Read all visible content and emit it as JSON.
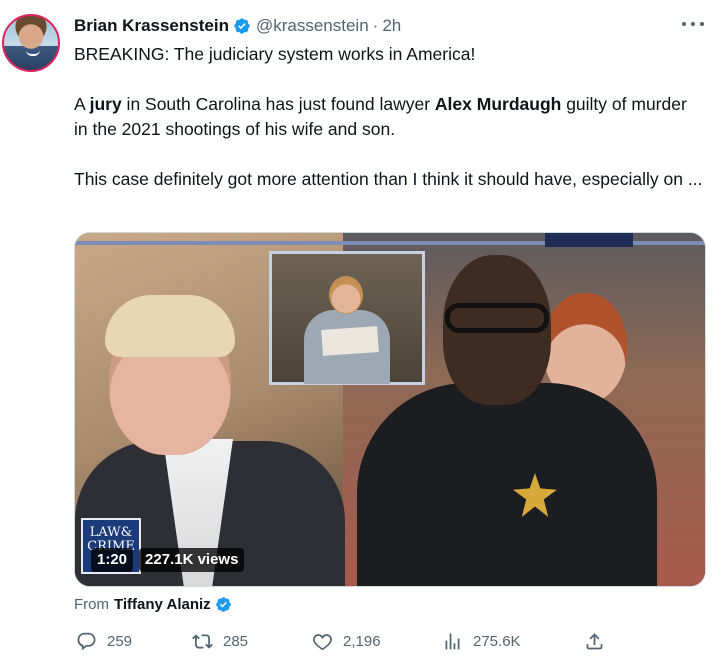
{
  "author": {
    "display_name": "Brian Krassenstein",
    "handle": "@krassenstein",
    "separator": "·",
    "time_ago": "2h"
  },
  "tweet": {
    "line1": "BREAKING:   The judiciary system works in America!",
    "p2_a": "A ",
    "p2_jury": "jury",
    "p2_b": " in South Carolina has just found lawyer ",
    "p2_name": "Alex Murdaugh",
    "p2_c": " guilty of murder in the 2021 shootings of his wife and son.",
    "p3": "This case definitely got more attention than I think it should have, especially on ..."
  },
  "media": {
    "logo_line1": "LAW&",
    "logo_line2": "CRIME",
    "duration": "1:20",
    "views": "227.1K views"
  },
  "attribution": {
    "prefix": "From",
    "name": "Tiffany Alaniz"
  },
  "actions": {
    "replies": "259",
    "retweets": "285",
    "likes": "2,196",
    "views": "275.6K"
  },
  "colors": {
    "verified_blue": "#1d9bf0",
    "secondary_text": "#536471",
    "avatar_ring": "#e0245e"
  }
}
